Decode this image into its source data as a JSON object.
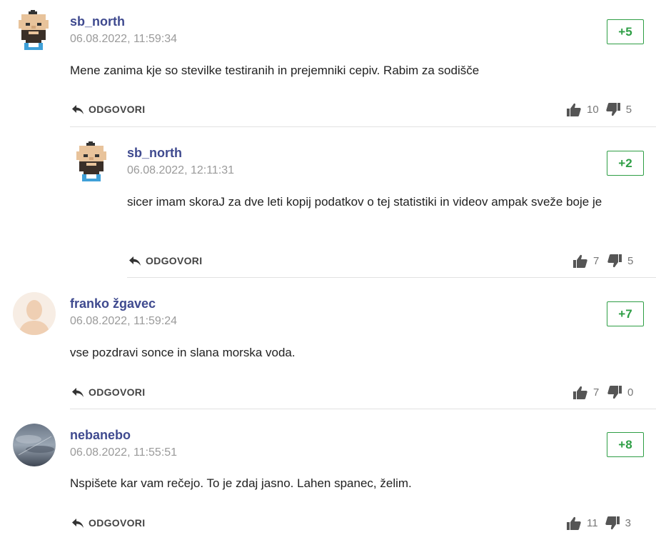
{
  "comments": [
    {
      "author": "sb_north",
      "date": "06.08.2022, 11:59:34",
      "score": "+5",
      "text": "Mene zanima kje so stevilke testiranih in prejemniki cepiv. Rabim za sodišče",
      "reply_label": "ODGOVORI",
      "likes": "10",
      "dislikes": "5"
    },
    {
      "author": "sb_north",
      "date": "06.08.2022, 12:11:31",
      "score": "+2",
      "text": "sicer imam skoraJ za dve leti kopij podatkov o tej statistiki in videov ampak sveže boje je",
      "reply_label": "ODGOVORI",
      "likes": "7",
      "dislikes": "5"
    },
    {
      "author": "franko žgavec",
      "date": "06.08.2022, 11:59:24",
      "score": "+7",
      "text": "vse pozdravi sonce in slana morska voda.",
      "reply_label": "ODGOVORI",
      "likes": "7",
      "dislikes": "0"
    },
    {
      "author": "nebanebo",
      "date": "06.08.2022, 11:55:51",
      "score": "+8",
      "text": "Nspišete kar vam rečejo. To je zdaj jasno. Lahen spanec, želim.",
      "reply_label": "ODGOVORI",
      "likes": "11",
      "dislikes": "3"
    }
  ],
  "colors": {
    "author": "#3f4a8f",
    "score": "#2e9e45",
    "muted": "#9a9a9a"
  },
  "icons": {
    "reply": "reply-arrow-icon",
    "like": "thumbs-up-icon",
    "dislike": "thumbs-down-icon"
  }
}
